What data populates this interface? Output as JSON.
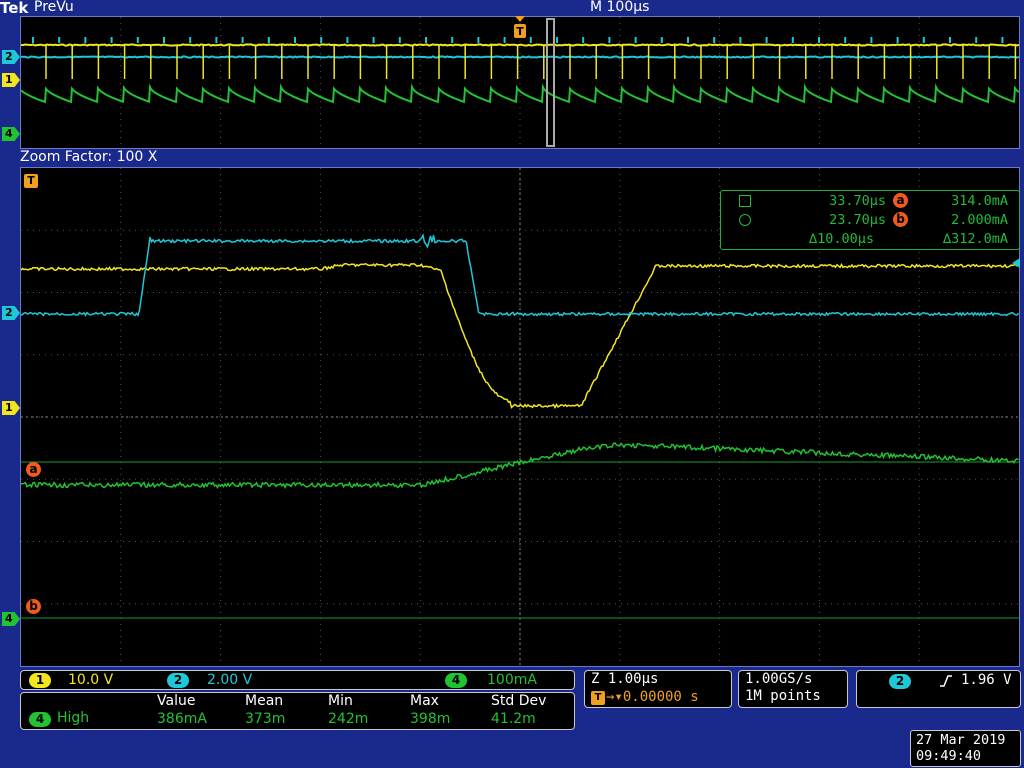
{
  "header": {
    "brand": "Tek",
    "mode": "PreVu",
    "timebase": "M 100µs"
  },
  "zoom": {
    "label": "Zoom Factor: 100 X"
  },
  "cursors": {
    "row1": {
      "time": "33.70µs",
      "badge": "a",
      "value": "314.0mA"
    },
    "row2": {
      "time": "23.70µs",
      "badge": "b",
      "value": "2.000mA"
    },
    "row3": {
      "delta_time": "∆10.00µs",
      "delta_value": "∆312.0mA"
    }
  },
  "markers": {
    "trigger": "T",
    "ch1": "1",
    "ch2": "2",
    "ch4": "4",
    "cursor_a": "a",
    "cursor_b": "b"
  },
  "channels": {
    "ch1": {
      "num": "1",
      "scale": "10.0 V",
      "color": "#f2e620"
    },
    "ch2": {
      "num": "2",
      "scale": "2.00 V",
      "color": "#1ec8d8"
    },
    "ch4": {
      "num": "4",
      "scale": "100mA",
      "color": "#22c233"
    }
  },
  "measurements": {
    "source": "4",
    "name": "High",
    "headers": [
      "Value",
      "Mean",
      "Min",
      "Max",
      "Std Dev"
    ],
    "values": [
      "386mA",
      "373m",
      "242m",
      "398m",
      "41.2m"
    ]
  },
  "horizontal": {
    "zoom_scale": "Z 1.00µs",
    "position": "→▾0.00000 s",
    "trigger_icon": "T"
  },
  "acquisition": {
    "sample_rate": "1.00GS/s",
    "record_length": "1M points"
  },
  "trigger": {
    "source": "2",
    "slope_icon": "rising-edge",
    "level": "1.96 V"
  },
  "datetime": {
    "date": "27 Mar 2019",
    "time": "09:49:40"
  },
  "colors": {
    "ch1": "#f2e620",
    "ch2": "#1ec8d8",
    "ch4": "#22c233",
    "cursor": "#f05a1a",
    "frame": "#1a2a8c",
    "grid": "#8a8a8a"
  }
}
